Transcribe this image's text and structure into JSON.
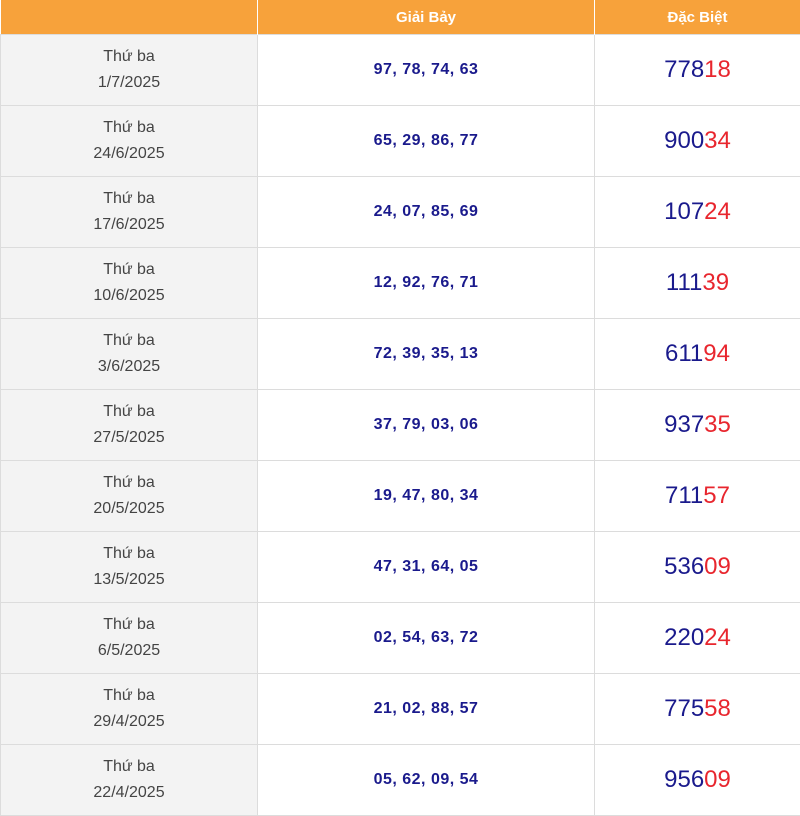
{
  "header": {
    "col_date": "",
    "col_g7": "Giải Bảy",
    "col_db": "Đặc Biệt"
  },
  "colors": {
    "header_bg": "#f7a23b",
    "number_blue": "#1a1a8c",
    "tail_red": "#e8262e",
    "date_bg": "#f3f3f3"
  },
  "rows": [
    {
      "day": "Thứ ba",
      "date": "1/7/2025",
      "g7": "97, 78, 74, 63",
      "db_head": "778",
      "db_tail": "18"
    },
    {
      "day": "Thứ ba",
      "date": "24/6/2025",
      "g7": "65, 29, 86, 77",
      "db_head": "900",
      "db_tail": "34"
    },
    {
      "day": "Thứ ba",
      "date": "17/6/2025",
      "g7": "24, 07, 85, 69",
      "db_head": "107",
      "db_tail": "24"
    },
    {
      "day": "Thứ ba",
      "date": "10/6/2025",
      "g7": "12, 92, 76, 71",
      "db_head": "111",
      "db_tail": "39"
    },
    {
      "day": "Thứ ba",
      "date": "3/6/2025",
      "g7": "72, 39, 35, 13",
      "db_head": "611",
      "db_tail": "94"
    },
    {
      "day": "Thứ ba",
      "date": "27/5/2025",
      "g7": "37, 79, 03, 06",
      "db_head": "937",
      "db_tail": "35"
    },
    {
      "day": "Thứ ba",
      "date": "20/5/2025",
      "g7": "19, 47, 80, 34",
      "db_head": "711",
      "db_tail": "57"
    },
    {
      "day": "Thứ ba",
      "date": "13/5/2025",
      "g7": "47, 31, 64, 05",
      "db_head": "536",
      "db_tail": "09"
    },
    {
      "day": "Thứ ba",
      "date": "6/5/2025",
      "g7": "02, 54, 63, 72",
      "db_head": "220",
      "db_tail": "24"
    },
    {
      "day": "Thứ ba",
      "date": "29/4/2025",
      "g7": "21, 02, 88, 57",
      "db_head": "775",
      "db_tail": "58"
    },
    {
      "day": "Thứ ba",
      "date": "22/4/2025",
      "g7": "05, 62, 09, 54",
      "db_head": "956",
      "db_tail": "09"
    }
  ]
}
